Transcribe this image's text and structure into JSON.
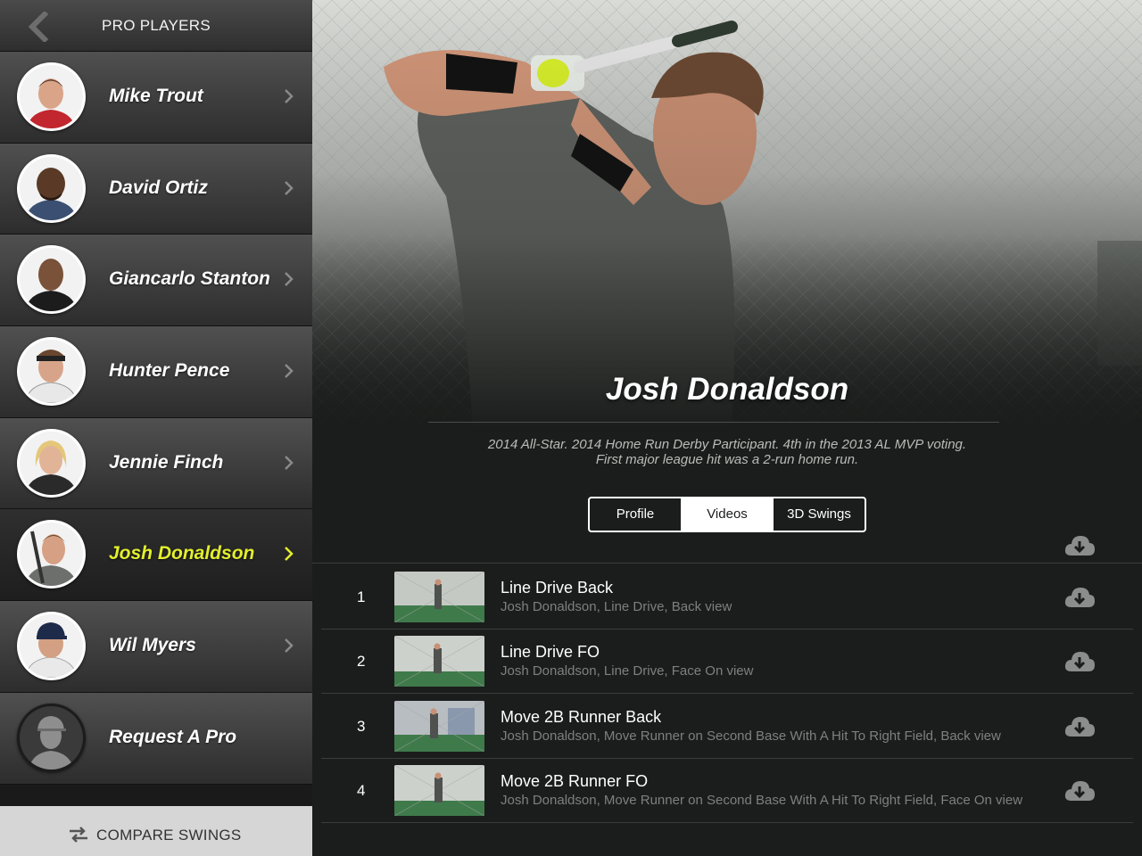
{
  "sidebar": {
    "title": "PRO PLAYERS",
    "players": [
      {
        "name": "Mike Trout"
      },
      {
        "name": "David Ortiz"
      },
      {
        "name": "Giancarlo Stanton"
      },
      {
        "name": "Hunter Pence"
      },
      {
        "name": "Jennie Finch"
      },
      {
        "name": "Josh Donaldson"
      },
      {
        "name": "Wil Myers"
      },
      {
        "name": "Request A Pro"
      }
    ],
    "selected_player": "Josh Donaldson",
    "compare_label": "COMPARE SWINGS"
  },
  "main": {
    "player_name": "Josh Donaldson",
    "bio_line1": "2014 All-Star. 2014 Home Run Derby Participant. 4th in the 2013 AL MVP voting.",
    "bio_line2": "First major league hit was a 2-run home run.",
    "tabs": [
      {
        "label": "Profile"
      },
      {
        "label": "Videos"
      },
      {
        "label": "3D Swings"
      }
    ],
    "active_tab": "Videos",
    "videos": [
      {
        "number": "1",
        "title": "Line Drive Back",
        "subtitle": "Josh Donaldson, Line Drive, Back view"
      },
      {
        "number": "2",
        "title": "Line Drive FO",
        "subtitle": "Josh Donaldson, Line Drive, Face On view"
      },
      {
        "number": "3",
        "title": "Move 2B Runner Back",
        "subtitle": "Josh Donaldson, Move Runner on Second Base With A Hit To Right Field, Back view"
      },
      {
        "number": "4",
        "title": "Move 2B Runner FO",
        "subtitle": "Josh Donaldson, Move Runner on Second Base With A Hit To Right Field, Face On view"
      }
    ]
  },
  "colors": {
    "accent": "#e3ef2d",
    "background": "#1b1d1c",
    "sidebar_item_top": "#505050",
    "sidebar_item_bottom": "#2d2d2d",
    "compare_bar": "#d6d6d6"
  },
  "icons": {
    "back": "chevron-left-icon",
    "row_arrow": "chevron-right-icon",
    "download": "cloud-download-icon",
    "compare": "swap-arrows-icon"
  }
}
